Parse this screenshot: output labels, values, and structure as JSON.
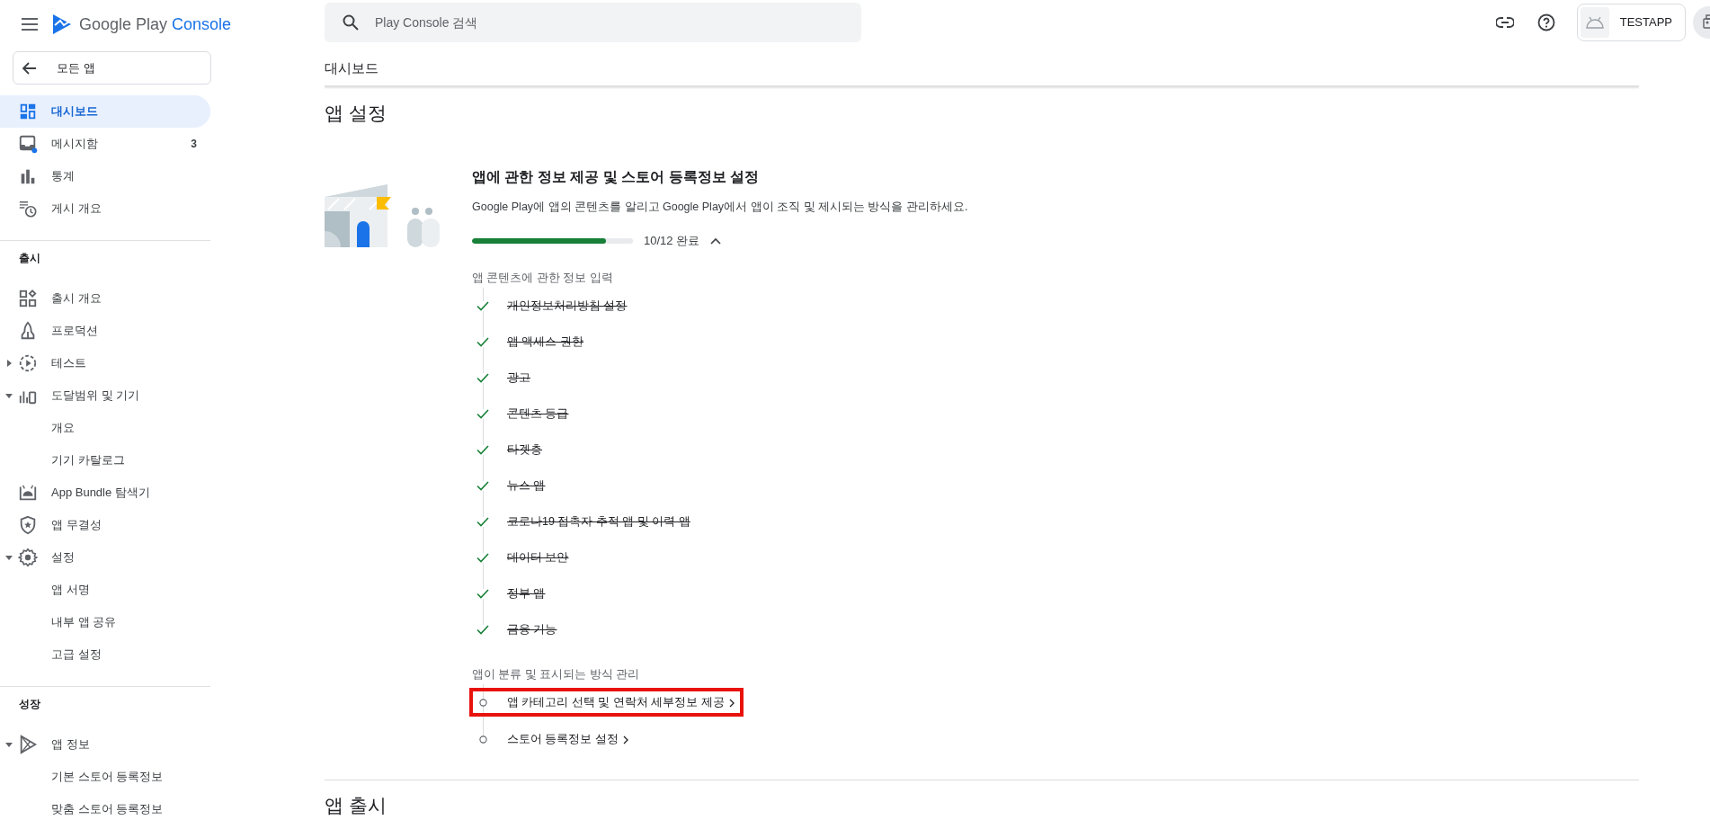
{
  "header": {
    "logo_text": "Google Play",
    "logo_accent": "Console",
    "search": {
      "placeholder": "Play Console 검색"
    },
    "app_chip": {
      "label": "TESTAPP"
    }
  },
  "sidebar": {
    "back_button": "모든 앱",
    "items": [
      {
        "kind": "item",
        "label": "대시보드",
        "selected": true
      },
      {
        "kind": "item",
        "label": "메시지함",
        "selected": false,
        "badge": "3"
      },
      {
        "kind": "item",
        "label": "통계",
        "selected": false
      },
      {
        "kind": "item",
        "label": "게시 개요",
        "selected": false
      },
      {
        "kind": "divider"
      },
      {
        "kind": "header",
        "label": "출시"
      },
      {
        "kind": "item",
        "label": "출시 개요",
        "selected": false
      },
      {
        "kind": "item",
        "label": "프로덕션",
        "selected": false
      },
      {
        "kind": "item",
        "label": "테스트",
        "selected": false,
        "expanded": false
      },
      {
        "kind": "item",
        "label": "도달범위 및 기기",
        "selected": false,
        "expanded": true
      },
      {
        "kind": "subitem",
        "label": "개요",
        "selected": false
      },
      {
        "kind": "subitem",
        "label": "기기 카탈로그",
        "selected": false
      },
      {
        "kind": "item",
        "label": "App Bundle 탐색기",
        "selected": false
      },
      {
        "kind": "item",
        "label": "앱 무결성",
        "selected": false
      },
      {
        "kind": "item",
        "label": "설정",
        "selected": false,
        "expanded": true
      },
      {
        "kind": "subitem",
        "label": "앱 서명",
        "selected": false
      },
      {
        "kind": "subitem",
        "label": "내부 앱 공유",
        "selected": false
      },
      {
        "kind": "subitem",
        "label": "고급 설정",
        "selected": false
      },
      {
        "kind": "divider"
      },
      {
        "kind": "header",
        "label": "성장"
      },
      {
        "kind": "item",
        "label": "앱 정보",
        "selected": false,
        "expanded": true
      },
      {
        "kind": "subitem",
        "label": "기본 스토어 등록정보",
        "selected": false
      },
      {
        "kind": "subitem",
        "label": "맞춤 스토어 등록정보",
        "selected": false
      }
    ]
  },
  "main": {
    "breadcrumb": "대시보드",
    "section_title": "앱 설정",
    "card": {
      "title": "앱에 관한 정보 제공 및 스토어 등록정보 설정",
      "description": "Google Play에 앱의 콘텐츠를 알리고 Google Play에서 앱이 조직 및 제시되는 방식을 관리하세요.",
      "progress": {
        "level": 0.83,
        "reading": "10/12 완료",
        "expanded": true
      },
      "groups": [
        {
          "label": "앱 콘텐츠에 관한 정보 입력",
          "tasks": [
            {
              "label": "개인정보처리방침 설정",
              "done": true,
              "highlighted": false
            },
            {
              "label": "앱 액세스 권한",
              "done": true,
              "highlighted": false
            },
            {
              "label": "광고",
              "done": true,
              "highlighted": false
            },
            {
              "label": "콘텐츠 등급",
              "done": true,
              "highlighted": false
            },
            {
              "label": "타겟층",
              "done": true,
              "highlighted": false
            },
            {
              "label": "뉴스 앱",
              "done": true,
              "highlighted": false
            },
            {
              "label": "코로나19 접촉자 추적 앱 및 이력 앱",
              "done": true,
              "highlighted": false
            },
            {
              "label": "데이터 보안",
              "done": true,
              "highlighted": false
            },
            {
              "label": "정부 앱",
              "done": true,
              "highlighted": false
            },
            {
              "label": "금융 기능",
              "done": true,
              "highlighted": false
            }
          ]
        },
        {
          "label": "앱이 분류 및 표시되는 방식 관리",
          "tasks": [
            {
              "label": "앱 카테고리 선택 및 연락처 세부정보 제공",
              "done": false,
              "highlighted": true
            },
            {
              "label": "스토어 등록정보 설정",
              "done": false,
              "highlighted": false
            }
          ]
        }
      ]
    },
    "next_section_title": "앱 출시"
  }
}
